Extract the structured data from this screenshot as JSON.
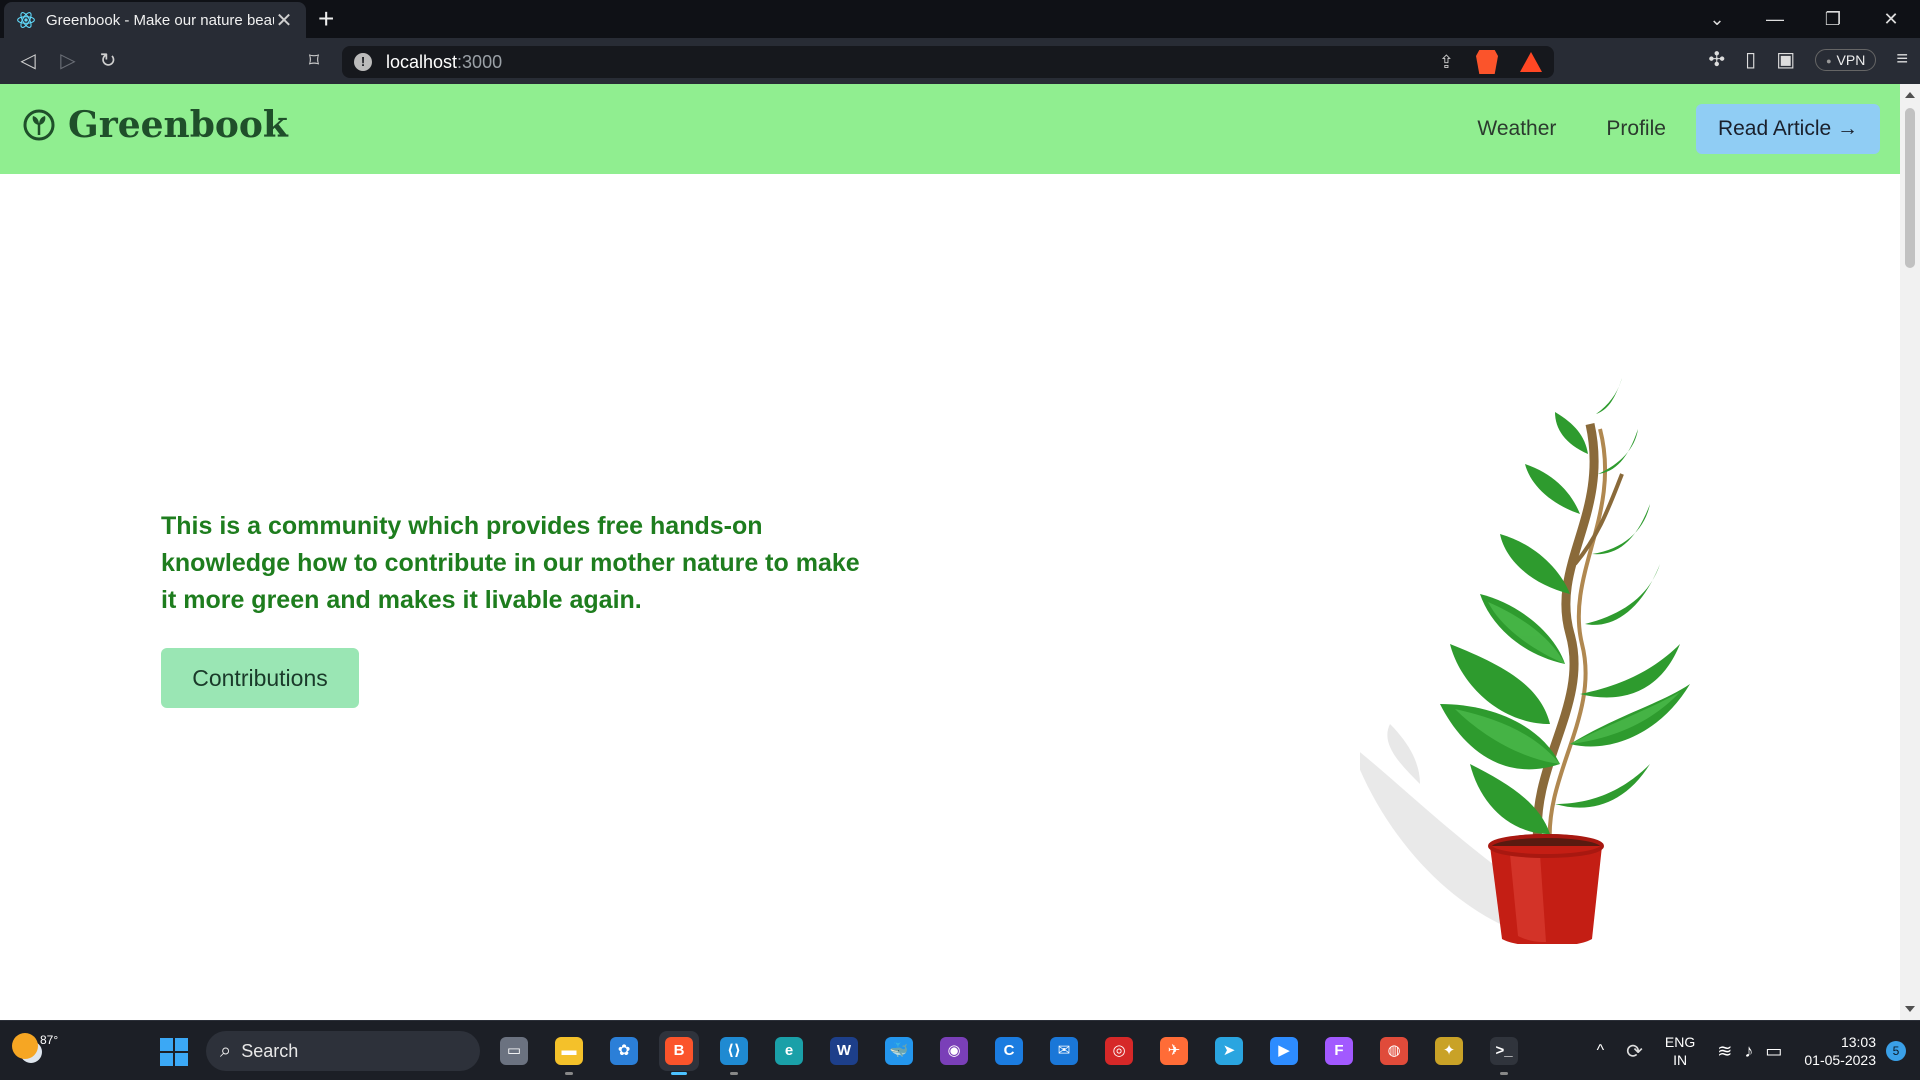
{
  "browser": {
    "tab_title": "Greenbook - Make our nature beautiful",
    "tab_close": "✕",
    "new_tab": "+",
    "url_host": "localhost",
    "url_port": ":3000",
    "window_controls": [
      "⌄",
      "—",
      "❐",
      "✕"
    ],
    "vpn_label": "VPN"
  },
  "site": {
    "brand": "Greenbook",
    "nav": {
      "weather": "Weather",
      "profile": "Profile",
      "read_article": "Read Article →"
    },
    "hero_text": "This is a community which provides free hands-on knowledge how to contribute in our mother nature to make it more green and makes it livable again.",
    "contributions_button": "Contributions",
    "colors": {
      "nav_bg": "#90ee90",
      "read_btn_bg": "#90cdf4",
      "hero_text": "#1e7d1e",
      "contrib_btn_bg": "#9ae6b4"
    }
  },
  "taskbar": {
    "weather_temp": "87°",
    "search_placeholder": "Search",
    "apps": [
      {
        "name": "task-view",
        "glyph": "▭",
        "color": "#6b7280"
      },
      {
        "name": "file-explorer",
        "glyph": "▬",
        "color": "#f4c12a"
      },
      {
        "name": "copilot",
        "glyph": "✿",
        "color": "#2b7fd8"
      },
      {
        "name": "brave-browser",
        "glyph": "B",
        "color": "#fb542b"
      },
      {
        "name": "vscode",
        "glyph": "⟨⟩",
        "color": "#1f8ad2"
      },
      {
        "name": "edge",
        "glyph": "e",
        "color": "#1aa0a8"
      },
      {
        "name": "app-w",
        "glyph": "W",
        "color": "#1d3f8a"
      },
      {
        "name": "docker",
        "glyph": "🐳",
        "color": "#2496ed"
      },
      {
        "name": "github-desktop",
        "glyph": "◉",
        "color": "#7a3fb8"
      },
      {
        "name": "app-c",
        "glyph": "C",
        "color": "#1b7ce0"
      },
      {
        "name": "mail",
        "glyph": "✉",
        "color": "#1a77d8"
      },
      {
        "name": "app-red",
        "glyph": "◎",
        "color": "#d62828"
      },
      {
        "name": "postman",
        "glyph": "✈",
        "color": "#ff6c37"
      },
      {
        "name": "telegram",
        "glyph": "➤",
        "color": "#2aa5e0"
      },
      {
        "name": "zoom",
        "glyph": "▶",
        "color": "#2d8cff"
      },
      {
        "name": "figma",
        "glyph": "F",
        "color": "#a259ff"
      },
      {
        "name": "chrome",
        "glyph": "◍",
        "color": "#e04b3a"
      },
      {
        "name": "app-colorful",
        "glyph": "✦",
        "color": "#c9a227"
      },
      {
        "name": "terminal",
        "glyph": ">_",
        "color": "#30343c"
      }
    ],
    "lang_line1": "ENG",
    "lang_line2": "IN",
    "time": "13:03",
    "date": "01-05-2023",
    "notifications": "5"
  }
}
